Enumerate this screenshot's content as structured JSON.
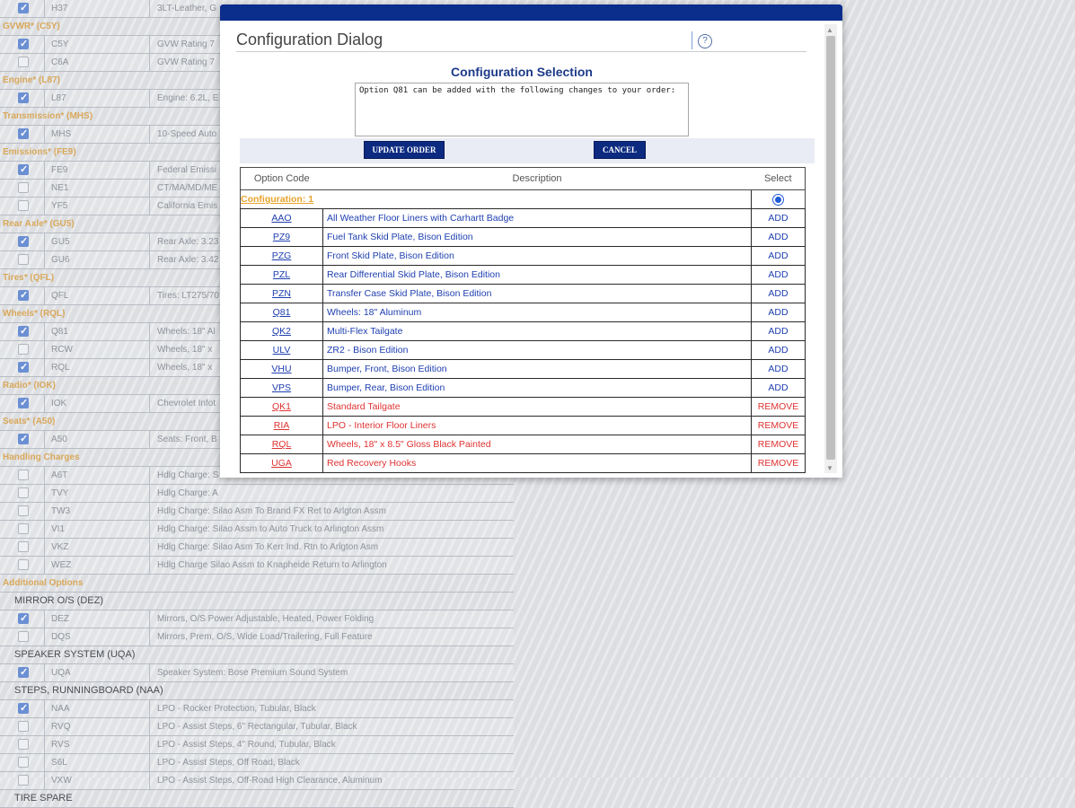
{
  "background_list": [
    {
      "kind": "opt",
      "checked": true,
      "code": "H37",
      "desc": "3LT-Leather, G"
    },
    {
      "kind": "grp",
      "label": "GVWR* (C5Y)"
    },
    {
      "kind": "opt",
      "checked": true,
      "code": "C5Y",
      "desc": "GVW Rating 7"
    },
    {
      "kind": "opt",
      "checked": false,
      "code": "C6A",
      "desc": "GVW Rating 7"
    },
    {
      "kind": "grp",
      "label": "Engine* (L87)"
    },
    {
      "kind": "opt",
      "checked": true,
      "code": "L87",
      "desc": "Engine: 6.2L, E"
    },
    {
      "kind": "grp",
      "label": "Transmission* (MHS)"
    },
    {
      "kind": "opt",
      "checked": true,
      "code": "MHS",
      "desc": "10-Speed Auto"
    },
    {
      "kind": "grp",
      "label": "Emissions* (FE9)"
    },
    {
      "kind": "opt",
      "checked": true,
      "code": "FE9",
      "desc": "Federal Emissi"
    },
    {
      "kind": "opt",
      "checked": false,
      "code": "NE1",
      "desc": "CT/MA/MD/ME"
    },
    {
      "kind": "opt",
      "checked": false,
      "code": "YF5",
      "desc": "California Emis"
    },
    {
      "kind": "grp",
      "label": "Rear Axle* (GU5)"
    },
    {
      "kind": "opt",
      "checked": true,
      "code": "GU5",
      "desc": "Rear Axle: 3.23"
    },
    {
      "kind": "opt",
      "checked": false,
      "code": "GU6",
      "desc": "Rear Axle: 3.42"
    },
    {
      "kind": "grp",
      "label": "Tires* (QFL)"
    },
    {
      "kind": "opt",
      "checked": true,
      "code": "QFL",
      "desc": "Tires: LT275/70"
    },
    {
      "kind": "grp",
      "label": "Wheels* (RQL)"
    },
    {
      "kind": "opt",
      "checked": true,
      "code": "Q81",
      "desc": "Wheels: 18\" Al"
    },
    {
      "kind": "opt",
      "checked": false,
      "code": "RCW",
      "desc": "Wheels, 18\" x"
    },
    {
      "kind": "opt",
      "checked": true,
      "code": "RQL",
      "desc": "Wheels, 18\" x"
    },
    {
      "kind": "grp",
      "label": "Radio* (IOK)"
    },
    {
      "kind": "opt",
      "checked": true,
      "code": "IOK",
      "desc": "Chevrolet Infot"
    },
    {
      "kind": "grp",
      "label": "Seats* (A50)"
    },
    {
      "kind": "opt",
      "checked": true,
      "code": "A50",
      "desc": "Seats: Front, B"
    },
    {
      "kind": "grp",
      "label": "Handling Charges"
    },
    {
      "kind": "opt",
      "checked": false,
      "code": "A6T",
      "desc": "Hdlg Charge: S"
    },
    {
      "kind": "opt",
      "checked": false,
      "code": "TVY",
      "desc": "Hdlg Charge: A"
    },
    {
      "kind": "opt",
      "checked": false,
      "code": "TW3",
      "desc": "Hdlg Charge: Silao Asm To Brand FX Ret to Arlgton Assm"
    },
    {
      "kind": "opt",
      "checked": false,
      "code": "VI1",
      "desc": "Hdlg Charge: Silao Assm to Auto Truck to Arlington Assm"
    },
    {
      "kind": "opt",
      "checked": false,
      "code": "VKZ",
      "desc": "Hdlg Charge: Silao Asm To Kerr Ind. Rtn to Arlgton Asm"
    },
    {
      "kind": "opt",
      "checked": false,
      "code": "WEZ",
      "desc": "Hdlg Charge Silao Assm to Knapheide Return to Arlington"
    },
    {
      "kind": "grp",
      "label": "Additional Options"
    },
    {
      "kind": "sub",
      "label": "MIRROR O/S  (DEZ)"
    },
    {
      "kind": "opt",
      "checked": true,
      "code": "DEZ",
      "desc": "Mirrors, O/S Power Adjustable, Heated, Power Folding"
    },
    {
      "kind": "opt",
      "checked": false,
      "code": "DQS",
      "desc": "Mirrors, Prem, O/S, Wide Load/Trailering, Full Feature"
    },
    {
      "kind": "sub",
      "label": "SPEAKER SYSTEM  (UQA)"
    },
    {
      "kind": "opt",
      "checked": true,
      "code": "UQA",
      "desc": "Speaker System: Bose Premium Sound System"
    },
    {
      "kind": "sub",
      "label": "STEPS, RUNNINGBOARD  (NAA)"
    },
    {
      "kind": "opt",
      "checked": true,
      "code": "NAA",
      "desc": "LPO - Rocker Protection, Tubular, Black"
    },
    {
      "kind": "opt",
      "checked": false,
      "code": "RVQ",
      "desc": "LPO - Assist Steps, 6\" Rectangular, Tubular, Black"
    },
    {
      "kind": "opt",
      "checked": false,
      "code": "RVS",
      "desc": "LPO - Assist Steps, 4\" Round, Tubular, Black"
    },
    {
      "kind": "opt",
      "checked": false,
      "code": "S6L",
      "desc": "LPO - Assist Steps, Off Road, Black"
    },
    {
      "kind": "opt",
      "checked": false,
      "code": "VXW",
      "desc": "LPO - Assist Steps, Off-Road High Clearance, Aluminum"
    },
    {
      "kind": "sub",
      "label": "TIRE SPARE"
    }
  ],
  "dialog": {
    "title": "Configuration Dialog",
    "help_glyph": "?",
    "section_heading": "Configuration Selection",
    "message": "Option Q81 can be added with the following changes to your order:",
    "update_button": "UPDATE ORDER",
    "cancel_button": "CANCEL",
    "table": {
      "headers": [
        "Option Code",
        "Description",
        "Select"
      ],
      "group_label": "Configuration: 1",
      "rows": [
        {
          "code": "AAO",
          "desc": "All Weather Floor Liners with Carhartt Badge",
          "action": "ADD"
        },
        {
          "code": "PZ9",
          "desc": "Fuel Tank Skid Plate, Bison Edition",
          "action": "ADD"
        },
        {
          "code": "PZG",
          "desc": "Front Skid Plate, Bison Edition",
          "action": "ADD"
        },
        {
          "code": "PZL",
          "desc": "Rear Differential Skid Plate, Bison Edition",
          "action": "ADD"
        },
        {
          "code": "PZN",
          "desc": "Transfer Case Skid Plate, Bison Edition",
          "action": "ADD"
        },
        {
          "code": "Q81",
          "desc": "Wheels: 18\" Aluminum",
          "action": "ADD"
        },
        {
          "code": "QK2",
          "desc": "Multi-Flex Tailgate",
          "action": "ADD"
        },
        {
          "code": "ULV",
          "desc": "ZR2 - Bison Edition",
          "action": "ADD"
        },
        {
          "code": "VHU",
          "desc": "Bumper, Front, Bison Edition",
          "action": "ADD"
        },
        {
          "code": "VPS",
          "desc": "Bumper, Rear, Bison Edition",
          "action": "ADD"
        },
        {
          "code": "QK1",
          "desc": "Standard Tailgate",
          "action": "REMOVE"
        },
        {
          "code": "RIA",
          "desc": "LPO - Interior Floor Liners",
          "action": "REMOVE"
        },
        {
          "code": "RQL",
          "desc": "Wheels, 18\" x 8.5\" Gloss Black Painted",
          "action": "REMOVE"
        },
        {
          "code": "UGA",
          "desc": "Red Recovery Hooks",
          "action": "REMOVE"
        }
      ]
    }
  },
  "colors": {
    "titlebar": "#0b2d8c",
    "add_text": "#1e3fb0",
    "remove_text": "#e03232",
    "group_label": "#e8a32c"
  }
}
